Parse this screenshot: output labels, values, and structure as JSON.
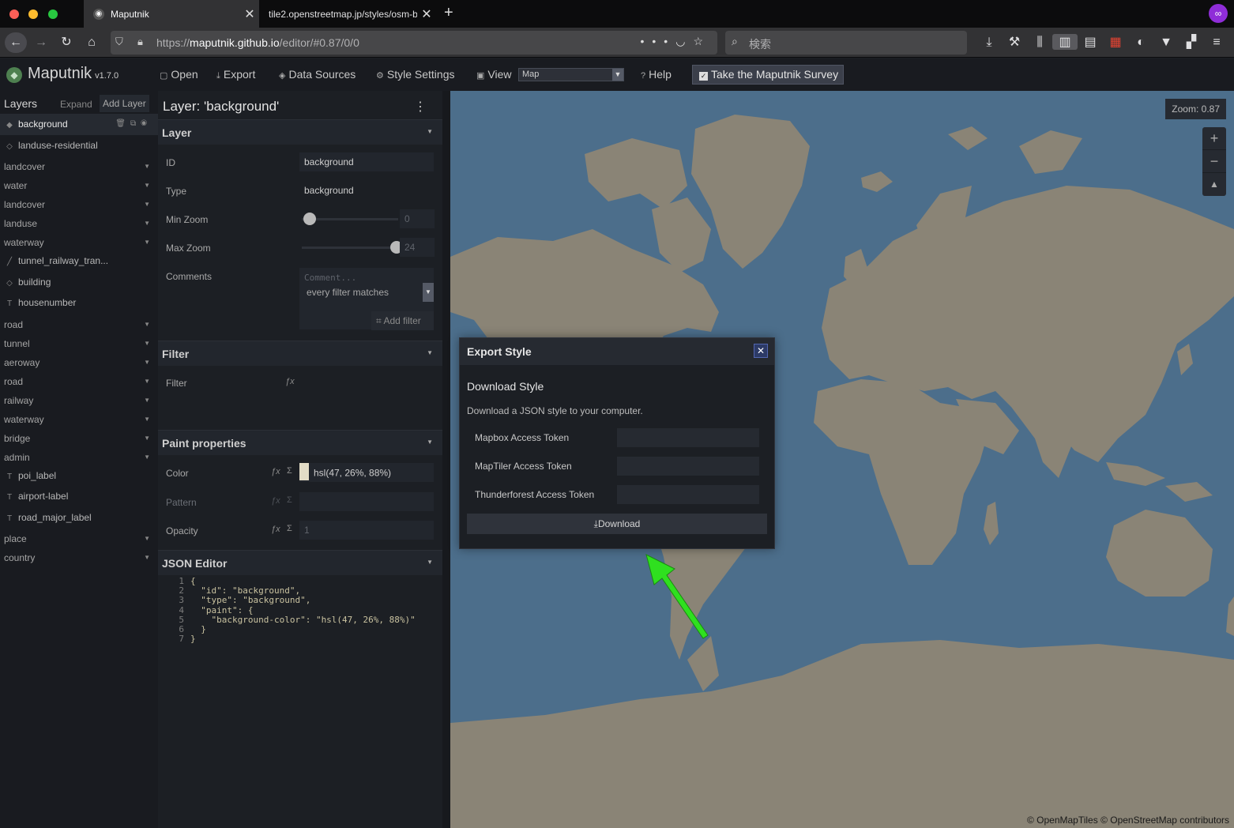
{
  "browser": {
    "tabs": [
      {
        "title": "Maputnik",
        "active": true
      },
      {
        "title": "tile2.openstreetmap.jp/styles/osm-b",
        "active": false
      }
    ],
    "url_prefix": "https://",
    "url_host": "maputnik.github.io",
    "url_path": "/editor/#0.87/0/0",
    "search_placeholder": "検索",
    "traffic_light_colors": [
      "#fe5f57",
      "#febc2e",
      "#28c840"
    ]
  },
  "app": {
    "name": "Maputnik",
    "version": "v1.7.0",
    "toolbar": {
      "open": "Open",
      "export": "Export",
      "data_sources": "Data Sources",
      "style_settings": "Style Settings",
      "view": "View",
      "view_value": "Map",
      "help": "Help",
      "survey": "Take the Maputnik Survey"
    }
  },
  "layer_list": {
    "title": "Layers",
    "expand": "Expand",
    "add_layer": "Add Layer",
    "items": [
      {
        "label": "background",
        "kind": "layer",
        "icon": "diamond-filled-icon",
        "active": true
      },
      {
        "label": "landuse-residential",
        "kind": "layer",
        "icon": "diamond-outline-icon"
      },
      {
        "label": "landcover",
        "kind": "group"
      },
      {
        "label": "water",
        "kind": "group"
      },
      {
        "label": "landcover",
        "kind": "group"
      },
      {
        "label": "landuse",
        "kind": "group"
      },
      {
        "label": "waterway",
        "kind": "group"
      },
      {
        "label": "tunnel_railway_tran...",
        "kind": "layer",
        "icon": "line-icon"
      },
      {
        "label": "building",
        "kind": "layer",
        "icon": "diamond-outline-icon"
      },
      {
        "label": "housenumber",
        "kind": "layer",
        "icon": "text-icon"
      },
      {
        "label": "road",
        "kind": "group"
      },
      {
        "label": "tunnel",
        "kind": "group"
      },
      {
        "label": "aeroway",
        "kind": "group"
      },
      {
        "label": "road",
        "kind": "group"
      },
      {
        "label": "railway",
        "kind": "group"
      },
      {
        "label": "waterway",
        "kind": "group"
      },
      {
        "label": "bridge",
        "kind": "group"
      },
      {
        "label": "admin",
        "kind": "group"
      },
      {
        "label": "poi_label",
        "kind": "layer",
        "icon": "text-icon"
      },
      {
        "label": "airport-label",
        "kind": "layer",
        "icon": "text-icon"
      },
      {
        "label": "road_major_label",
        "kind": "layer",
        "icon": "text-icon"
      },
      {
        "label": "place",
        "kind": "group"
      },
      {
        "label": "country",
        "kind": "group"
      }
    ]
  },
  "editor": {
    "title": "Layer: 'background'",
    "sections": {
      "layer": "Layer",
      "filter": "Filter",
      "paint": "Paint properties",
      "json": "JSON Editor"
    },
    "fields": {
      "id_label": "ID",
      "id_value": "background",
      "type_label": "Type",
      "type_value": "background",
      "minzoom_label": "Min Zoom",
      "minzoom_value": "0",
      "minzoom_fraction": 0,
      "maxzoom_label": "Max Zoom",
      "maxzoom_value": "24",
      "maxzoom_fraction": 1,
      "comments_label": "Comments",
      "comments_placeholder": "Comment...",
      "filter_label": "Filter",
      "filter_value": "every filter matches",
      "add_filter": "Add filter",
      "color_label": "Color",
      "color_value": "hsl(47, 26%, 88%)",
      "pattern_label": "Pattern",
      "opacity_label": "Opacity",
      "opacity_value": "1"
    },
    "json_lines": [
      "{",
      "  \"id\": \"background\",",
      "  \"type\": \"background\",",
      "  \"paint\": {",
      "    \"background-color\": \"hsl(47, 26%, 88%)\"",
      "  }",
      "}"
    ]
  },
  "map": {
    "zoom_label": "Zoom: 0.87",
    "attribution": "© OpenMapTiles © OpenStreetMap contributors",
    "ocean_color": "#4c6e8b",
    "land_color": "#8a8476"
  },
  "export_modal": {
    "title": "Export Style",
    "heading": "Download Style",
    "description": "Download a JSON style to your computer.",
    "tokens": [
      {
        "label": "Mapbox Access Token",
        "value": ""
      },
      {
        "label": "MapTiler Access Token",
        "value": ""
      },
      {
        "label": "Thunderforest Access Token",
        "value": ""
      }
    ],
    "download": "Download"
  },
  "annotation": {
    "arrow_color": "#2fe01f"
  }
}
